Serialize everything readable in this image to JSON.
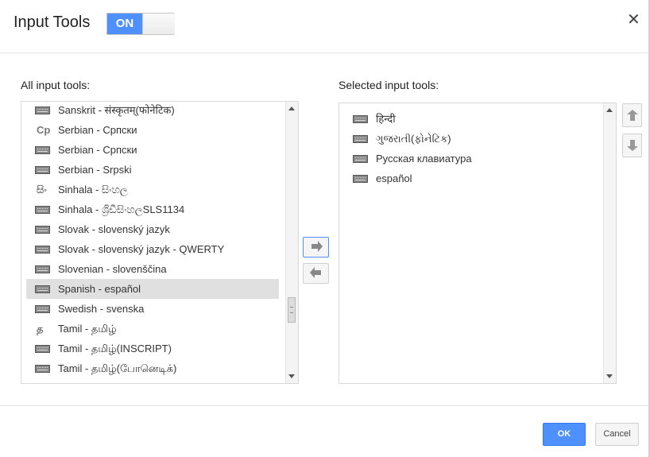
{
  "dialog": {
    "title": "Input Tools",
    "toggle_label": "ON",
    "close_glyph": "✕"
  },
  "all_tools": {
    "label": "All input tools:",
    "items": [
      {
        "icon": "keyboard-icon",
        "text": "Sanskrit -   संस्कृतम्(फोनेटिक)",
        "selected": false
      },
      {
        "icon": "cp-icon",
        "text": "Serbian -   Српски",
        "selected": false
      },
      {
        "icon": "keyboard-icon",
        "text": "Serbian -   Српски",
        "selected": false
      },
      {
        "icon": "keyboard-icon",
        "text": "Serbian -   Srpski",
        "selected": false
      },
      {
        "icon": "sinhala-glyph-icon",
        "text": "Sinhala -   සිංහල",
        "selected": false
      },
      {
        "icon": "keyboard-icon",
        "text": "Sinhala -   ශ්‍රිඩීසිංහලSLS1134",
        "selected": false
      },
      {
        "icon": "keyboard-icon",
        "text": "Slovak -   slovenský jazyk",
        "selected": false
      },
      {
        "icon": "keyboard-icon",
        "text": "Slovak -   slovenský jazyk - QWERTY",
        "selected": false
      },
      {
        "icon": "keyboard-icon",
        "text": "Slovenian -   slovenščina",
        "selected": false
      },
      {
        "icon": "keyboard-icon",
        "text": "Spanish -   español",
        "selected": true
      },
      {
        "icon": "keyboard-icon",
        "text": "Swedish -   svenska",
        "selected": false
      },
      {
        "icon": "tamil-glyph-icon",
        "text": "Tamil -   தமிழ்",
        "selected": false
      },
      {
        "icon": "keyboard-icon",
        "text": "Tamil -   தமிழ்(INSCRIPT)",
        "selected": false
      },
      {
        "icon": "keyboard-icon",
        "text": "Tamil -   தமிழ்(போனெடிக்)",
        "selected": false
      }
    ]
  },
  "selected_tools": {
    "label": "Selected input tools:",
    "items": [
      {
        "icon": "keyboard-icon",
        "text": "हिन्दी"
      },
      {
        "icon": "keyboard-icon",
        "text": "ગુજરાતી(ફોનેટિક)"
      },
      {
        "icon": "keyboard-icon",
        "text": "Русская клавиатура"
      },
      {
        "icon": "keyboard-icon",
        "text": "español"
      }
    ]
  },
  "glyphs": {
    "cp": "Cp",
    "sinhala": "සිං",
    "tamil": "த"
  },
  "footer": {
    "ok_label": "OK",
    "cancel_label": "Cancel"
  },
  "colors": {
    "accent": "#4d90fe",
    "selection": "#e0e0e0"
  }
}
